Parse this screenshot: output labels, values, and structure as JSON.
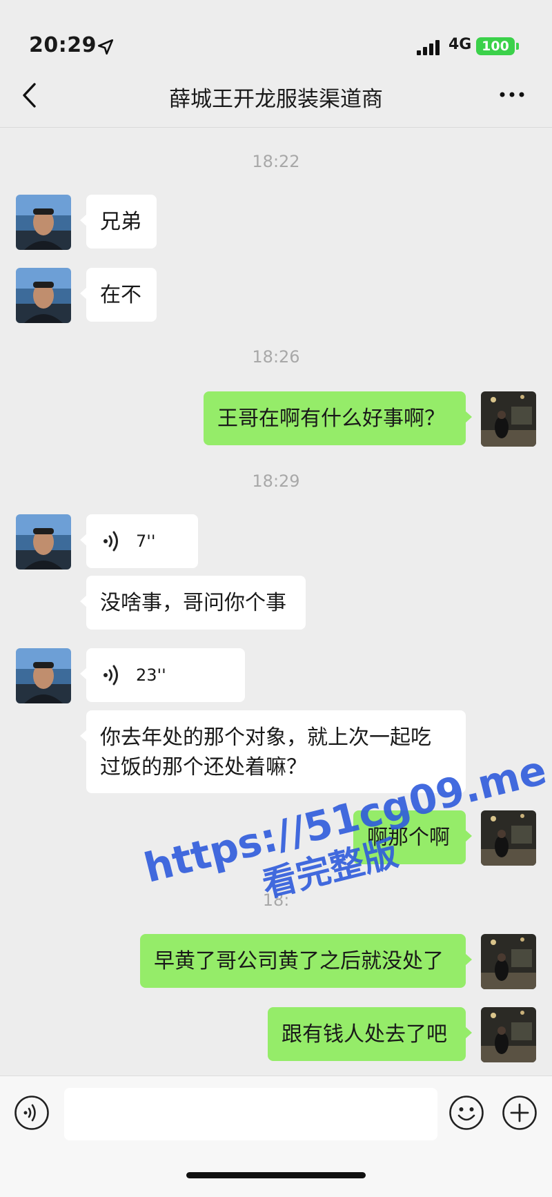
{
  "status_bar": {
    "time": "20:29",
    "network": "4G",
    "battery": "100"
  },
  "header": {
    "title": "薛城王开龙服装渠道商"
  },
  "timestamps": [
    "18:22",
    "18:26",
    "18:29",
    "18:"
  ],
  "messages": [
    {
      "side": "left",
      "type": "text",
      "text": "兄弟"
    },
    {
      "side": "left",
      "type": "text",
      "text": "在不"
    },
    {
      "side": "right",
      "type": "text",
      "text": "王哥在啊有什么好事啊？"
    },
    {
      "side": "left",
      "type": "voice",
      "duration": "7''"
    },
    {
      "side": "left",
      "type": "text",
      "text": "没啥事，哥问你个事"
    },
    {
      "side": "left",
      "type": "voice",
      "duration": "23''"
    },
    {
      "side": "left",
      "type": "text",
      "line1": "你去年处的那个对象，就上次一起吃",
      "line2": "过饭的那个还处着嘛？"
    },
    {
      "side": "right",
      "type": "text",
      "text": "啊那个啊"
    },
    {
      "side": "right",
      "type": "text",
      "text": "早黄了哥公司黄了之后就没处了"
    },
    {
      "side": "right",
      "type": "text",
      "text": "跟有钱人处去了吧"
    }
  ],
  "watermark": {
    "line1": "https://51cg09.me",
    "line2": "看完整版"
  },
  "icons": {
    "location": "location-arrow-icon",
    "back": "chevron-left-icon",
    "more": "more-dots-icon",
    "voice": "voice-wave-icon",
    "emoji": "smiley-icon",
    "plus": "plus-circle-icon"
  },
  "colors": {
    "background": "#ededed",
    "self_bubble": "#95ec69",
    "other_bubble": "#ffffff",
    "battery": "#3bd14a",
    "watermark": "#2f5bdc"
  }
}
